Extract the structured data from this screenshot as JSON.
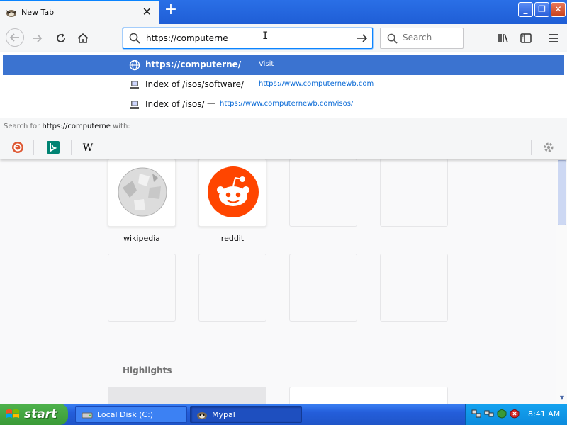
{
  "window": {
    "tab_title": "New Tab",
    "new_tab_symbol": "+",
    "min": "_",
    "restore": "❐",
    "close": "✕"
  },
  "toolbar": {
    "url_value": "https://computerne",
    "search_placeholder": "Search"
  },
  "autocomplete": {
    "items": [
      {
        "title": "https://computerne/",
        "separator": "—",
        "action": "Visit"
      },
      {
        "title": "Index of /isos/software/",
        "separator": "—",
        "url": "https://www.computernewb.com"
      },
      {
        "title": "Index of /isos/",
        "separator": "—",
        "url": "https://www.computernewb.com/isos/"
      }
    ],
    "search_with_prefix": "Search for",
    "search_with_query": "https://computerne",
    "search_with_suffix": "with:",
    "engines": [
      "duckduckgo",
      "bing",
      "wikipedia"
    ],
    "wikipedia_glyph": "W"
  },
  "content": {
    "top_sites": [
      {
        "label": "wikipedia"
      },
      {
        "label": "reddit"
      }
    ],
    "highlights_title": "Highlights"
  },
  "taskbar": {
    "start_label": "start",
    "tasks": [
      {
        "label": "Local Disk (C:)"
      },
      {
        "label": "Mypal"
      }
    ],
    "clock": "8:41 AM"
  },
  "colors": {
    "accent": "#0a84ff",
    "selected_row": "#3b73d0",
    "xp_blue": "#245edb",
    "start_green": "#3a9a37"
  }
}
